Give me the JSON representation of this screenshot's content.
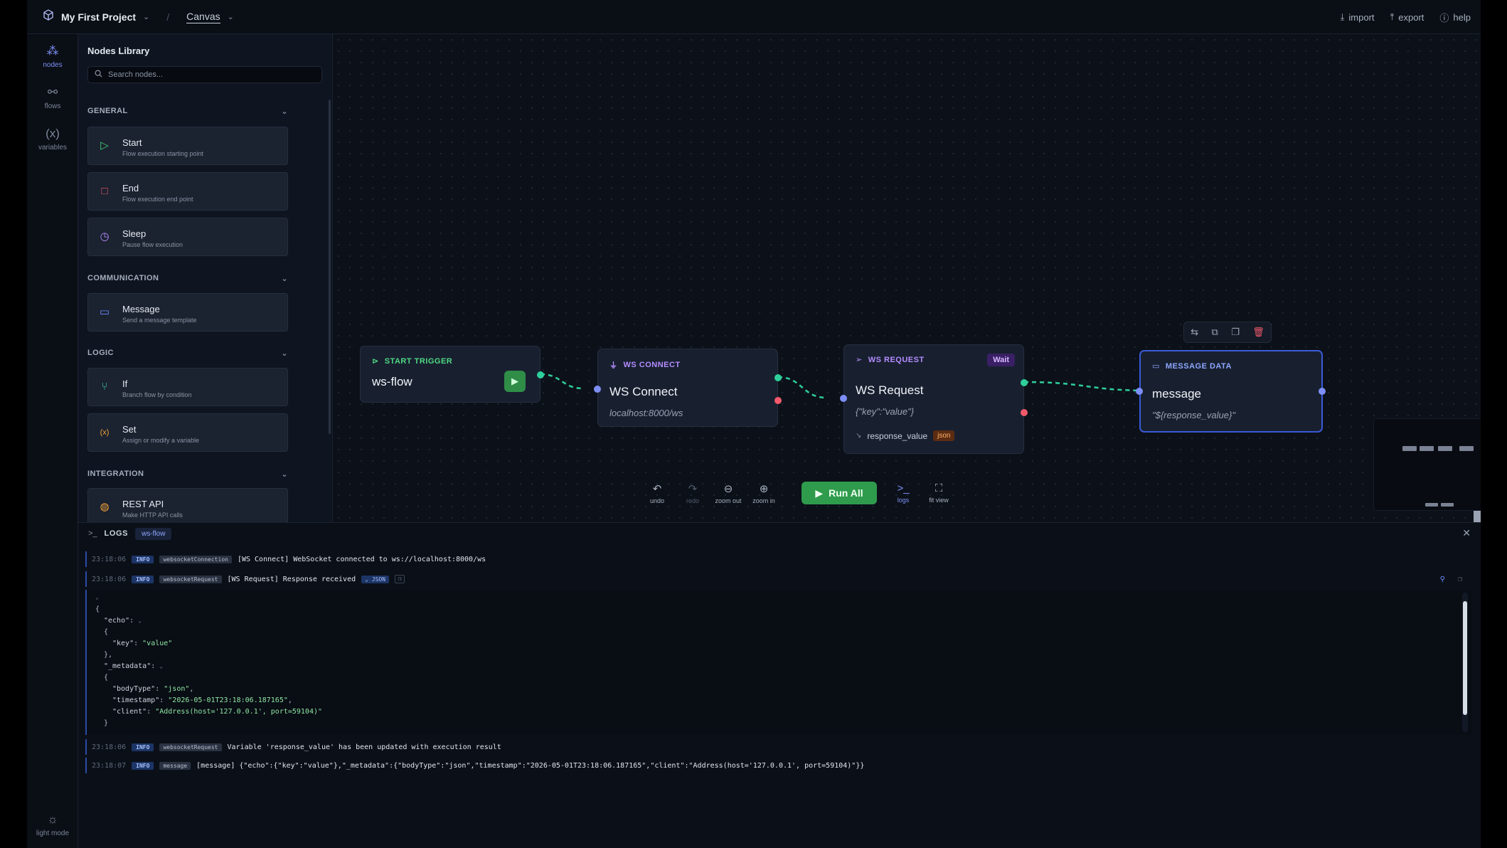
{
  "topbar": {
    "project": "My First Project",
    "view": "Canvas",
    "actions": [
      "import",
      "export",
      "help"
    ]
  },
  "rail": {
    "items": [
      "nodes",
      "flows",
      "variables"
    ],
    "bottom": "light mode"
  },
  "library": {
    "title": "Nodes Library",
    "search_placeholder": "Search nodes...",
    "sections": [
      {
        "name": "GENERAL",
        "items": [
          {
            "name": "Start",
            "desc": "Flow execution starting point"
          },
          {
            "name": "End",
            "desc": "Flow execution end point"
          },
          {
            "name": "Sleep",
            "desc": "Pause flow execution"
          }
        ]
      },
      {
        "name": "COMMUNICATION",
        "items": [
          {
            "name": "Message",
            "desc": "Send a message template"
          }
        ]
      },
      {
        "name": "LOGIC",
        "items": [
          {
            "name": "If",
            "desc": "Branch flow by condition"
          },
          {
            "name": "Set",
            "desc": "Assign or modify a variable"
          }
        ]
      },
      {
        "name": "INTEGRATION",
        "items": [
          {
            "name": "REST API",
            "desc": "Make HTTP API calls"
          }
        ]
      }
    ]
  },
  "canvas": {
    "nodes": {
      "start": {
        "type": "START TRIGGER",
        "title": "ws-flow"
      },
      "connect": {
        "type": "WS CONNECT",
        "title": "WS Connect",
        "sub": "localhost:8000/ws"
      },
      "request": {
        "type": "WS REQUEST",
        "badge": "Wait",
        "title": "WS Request",
        "sub": "{\"key\":\"value\"}",
        "output": "response_value",
        "output_type": "json"
      },
      "message": {
        "type": "MESSAGE DATA",
        "title": "message",
        "sub": "\"${response_value}\""
      }
    },
    "controls": {
      "undo": "undo",
      "redo": "redo",
      "zoom_out": "zoom out",
      "zoom_in": "zoom in",
      "run_all": "Run All",
      "logs": "logs",
      "fit_view": "fit view"
    }
  },
  "logs": {
    "title": "LOGS",
    "tab": "ws-flow",
    "rows": [
      {
        "time": "23:18:06",
        "level": "INFO",
        "source": "websocketConnection",
        "message": "[WS Connect] WebSocket connected to ws://localhost:8000/ws"
      },
      {
        "time": "23:18:06",
        "level": "INFO",
        "source": "websocketRequest",
        "message": "[WS Request] Response received",
        "toggle": "JSON"
      },
      {
        "time": "23:18:06",
        "level": "INFO",
        "source": "websocketRequest",
        "message": "Variable 'response_value' has been updated with execution result"
      },
      {
        "time": "23:18:07",
        "level": "INFO",
        "source": "message",
        "message": "[message] {\"echo\":{\"key\":\"value\"},\"_metadata\":{\"bodyType\":\"json\",\"timestamp\":\"2026-05-01T23:18:06.187165\",\"client\":\"Address(host='127.0.0.1', port=59104)\"}}"
      }
    ],
    "json": {
      "echo_key": "\"echo\"",
      "key": "\"key\"",
      "key_value": "\"value\"",
      "meta_key": "\"_metadata\"",
      "body_type_key": "\"bodyType\"",
      "body_type_value": "\"json\"",
      "timestamp_key": "\"timestamp\"",
      "timestamp_value": "\"2026-05-01T23:18:06.187165\"",
      "client_key": "\"client\"",
      "client_value": "\"Address(host='127.0.0.1', port=59104)\""
    }
  },
  "colors": {
    "accent": "#7d8ff6",
    "success": "#2f9b4c",
    "edge": "#2ecf9b",
    "error_port": "#f25a6b",
    "message_border": "#3a5ad6"
  }
}
